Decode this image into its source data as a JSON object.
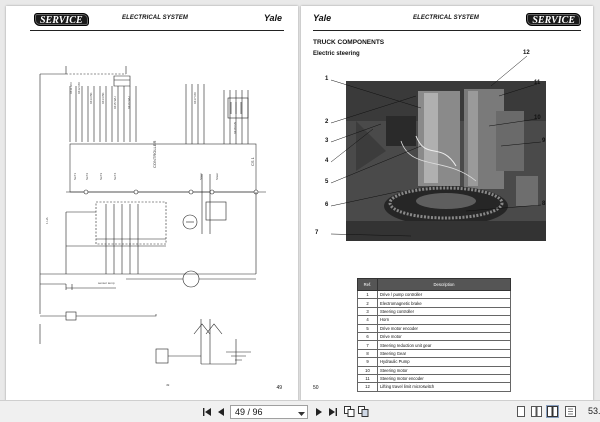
{
  "left_page": {
    "header": {
      "badge": "SERVICE",
      "title": "ELECTRICAL SYSTEM",
      "brand": "Yale"
    },
    "page_number": "49",
    "diagram_labels": [
      "CONTROLLER",
      "CS 1"
    ]
  },
  "right_page": {
    "header": {
      "brand": "Yale",
      "title": "ELECTRICAL SYSTEM",
      "badge": "SERVICE"
    },
    "section_title": "TRUCK COMPONENTS",
    "subsection_title": "Electric steering",
    "callouts": [
      "1",
      "2",
      "3",
      "4",
      "5",
      "6",
      "7",
      "8",
      "9",
      "10",
      "11",
      "12"
    ],
    "table": {
      "headers": [
        "Ref.",
        "Description"
      ],
      "rows": [
        [
          "1",
          "Drive / pump controller"
        ],
        [
          "2",
          "Electromagnetic brake"
        ],
        [
          "3",
          "Steering controller"
        ],
        [
          "4",
          "Horn"
        ],
        [
          "5",
          "Drive motor encoder"
        ],
        [
          "6",
          "Drive motor"
        ],
        [
          "7",
          "Steering reduction unit gear"
        ],
        [
          "8",
          "Steering Gear"
        ],
        [
          "9",
          "Hydraulic Pump"
        ],
        [
          "10",
          "Steering motor"
        ],
        [
          "11",
          "Steering motor encoder"
        ],
        [
          "12",
          "Lifting travel limit microswitch"
        ]
      ]
    },
    "page_number": "50"
  },
  "toolbar": {
    "page_indicator": "49 / 96",
    "zoom": "53.",
    "icons": [
      "first-page-icon",
      "prev-page-icon",
      "next-page-icon",
      "last-page-icon",
      "copy-pages-icon",
      "fit-pages-icon",
      "single-page-icon",
      "two-page-icon",
      "continuous-icon",
      "scroll-view-icon"
    ]
  },
  "colors": {
    "accent": "#1a1a1a",
    "toolbar_bg": "#f0f0f0",
    "viewer_bg": "#e9e9e9"
  }
}
